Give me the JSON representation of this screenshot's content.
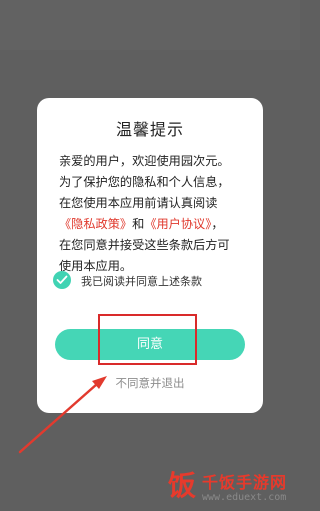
{
  "dialog": {
    "title": "温馨提示",
    "body_lines": [
      "亲爱的用户，欢迎使用园次元。",
      "为了保护您的隐私和个人信息，",
      "在您使用本应用前请认真阅读"
    ],
    "privacy_link": "《隐私政策》",
    "and_text": "和",
    "agreement_link": "《用户协议》",
    "line4_end": "，",
    "body_lines_after": [
      "在您同意并接受这些条款后方可",
      "使用本应用。"
    ],
    "checkbox_label": "我已阅读并同意上述条款",
    "agree_button": "同意",
    "decline_text": "不同意并退出"
  },
  "watermark": {
    "icon_glyph": "饭",
    "title": "千饭手游网",
    "url": "www.eduext.com"
  },
  "colors": {
    "accent": "#45d6b6",
    "link": "#e0392d",
    "highlight": "#d92a2a"
  }
}
